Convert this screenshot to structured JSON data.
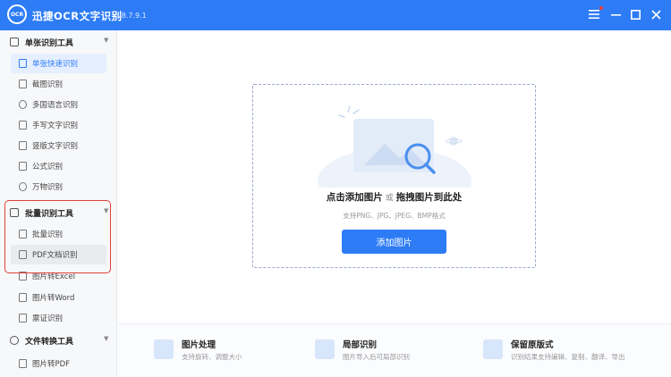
{
  "app": {
    "logo_text": "OCR",
    "title": "迅捷OCR文字识别",
    "version": "v8.7.9.1"
  },
  "window_controls": [
    "menu-icon",
    "minimize-icon",
    "maximize-icon",
    "close-icon"
  ],
  "sidebar": {
    "groups": [
      {
        "label": "单张识别工具",
        "items": [
          {
            "label": "单张快速识别",
            "active": true
          },
          {
            "label": "截图识别"
          },
          {
            "label": "多国语言识别"
          },
          {
            "label": "手写文字识别"
          },
          {
            "label": "竖版文字识别"
          },
          {
            "label": "公式识别"
          },
          {
            "label": "万物识别"
          }
        ]
      },
      {
        "label": "批量识别工具",
        "items": [
          {
            "label": "批量识别"
          },
          {
            "label": "PDF文档识别",
            "selected": true
          },
          {
            "label": "图片转Excel"
          },
          {
            "label": "图片转Word"
          },
          {
            "label": "票证识别"
          }
        ]
      },
      {
        "label": "文件转换工具",
        "items": [
          {
            "label": "图片转PDF"
          }
        ]
      }
    ]
  },
  "dropzone": {
    "title_click": "点击添加图片",
    "title_or": "或",
    "title_drag": "拖拽图片到此处",
    "formats": "支持PNG、JPG、JPEG、BMP格式",
    "button": "添加图片"
  },
  "features": [
    {
      "title": "图片处理",
      "desc": "支持旋转、调整大小"
    },
    {
      "title": "局部识别",
      "desc": "图片导入后可局部识别"
    },
    {
      "title": "保留原版式",
      "desc": "识别结果支持编辑、复制、翻译、导出"
    }
  ],
  "colors": {
    "brand": "#2d7cf6",
    "highlight_box": "#e0403a"
  }
}
